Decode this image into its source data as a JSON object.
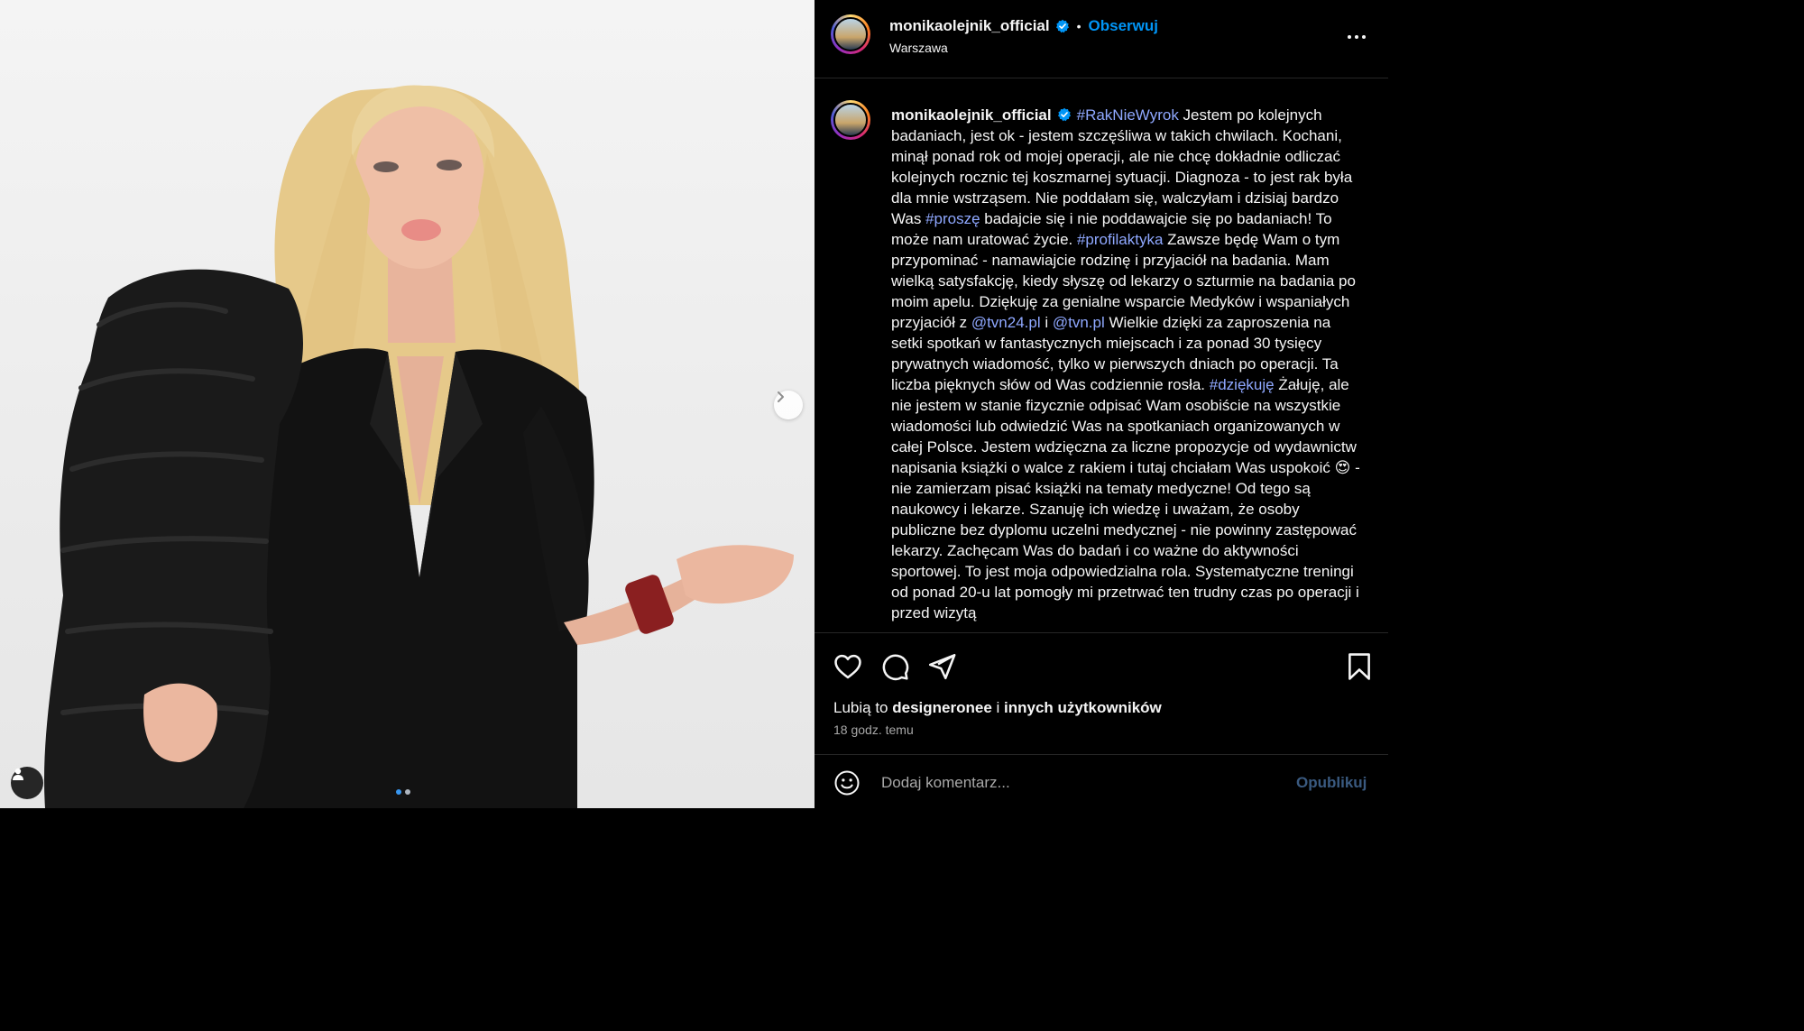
{
  "post": {
    "media": {
      "description_icon": "user-tag-icon",
      "carousel": {
        "count": 2,
        "active": 0
      }
    },
    "header": {
      "username": "monikaolejnik_official",
      "separator": "•",
      "follow_label": "Obserwuj",
      "location": "Warszawa"
    },
    "caption": {
      "username": "monikaolejnik_official",
      "segments": [
        {
          "t": "tag",
          "v": "#RakNieWyrok"
        },
        {
          "t": "text",
          "v": " Jestem po kolejnych badaniach, jest ok - jestem szczęśliwa w takich chwilach. Kochani, minął ponad rok od mojej operacji, ale nie chcę dokładnie odliczać kolejnych rocznic tej koszmarnej sytuacji. Diagnoza - to jest rak była dla mnie wstrząsem. Nie poddałam się, walczyłam i dzisiaj bardzo Was "
        },
        {
          "t": "tag",
          "v": "#proszę"
        },
        {
          "t": "text",
          "v": " badajcie się i nie poddawajcie się po badaniach! To może nam uratować życie. "
        },
        {
          "t": "tag",
          "v": "#profilaktyka"
        },
        {
          "t": "text",
          "v": " Zawsze będę Wam o tym przypominać - namawiajcie rodzinę i przyjaciół na badania. Mam wielką satysfakcję, kiedy słyszę od lekarzy o szturmie na badania po moim apelu. Dziękuję za genialne wsparcie Medyków i wspaniałych przyjaciół z "
        },
        {
          "t": "tag",
          "v": "@tvn24.pl"
        },
        {
          "t": "text",
          "v": " i "
        },
        {
          "t": "tag",
          "v": "@tvn.pl"
        },
        {
          "t": "text",
          "v": " Wielkie dzięki za zaproszenia na setki spotkań w fantastycznych miejscach i za ponad 30 tysięcy prywatnych wiadomość, tylko w pierwszych dniach po operacji. Ta liczba pięknych słów od Was codziennie rosła. "
        },
        {
          "t": "tag",
          "v": "#dziękuję"
        },
        {
          "t": "text",
          "v": " Żałuję, ale nie jestem w stanie fizycznie odpisać Wam osobiście na wszystkie wiadomości lub odwiedzić Was na spotkaniach organizowanych w całej Polsce. Jestem wdzięczna za liczne propozycje od wydawnictw napisania książki o walce z rakiem i tutaj chciałam Was uspokoić 😍 - nie zamierzam pisać książki na tematy medyczne! Od tego są naukowcy i lekarze. Szanuję ich wiedzę i uważam, że osoby publiczne bez dyplomu uczelni medycznej - nie powinny zastępować lekarzy. Zachęcam Was do badań i co ważne do aktywności sportowej. To jest moja odpowiedzialna rola. Systematyczne treningi od ponad 20-u lat pomogły mi przetrwać ten trudny czas po operacji i przed wizytą"
        }
      ]
    },
    "actions": {
      "like_icon": "heart-icon",
      "comment_icon": "comment-icon",
      "share_icon": "paper-plane-icon",
      "save_icon": "bookmark-icon"
    },
    "likes": {
      "prefix": "Lubią to ",
      "user": "designeronee",
      "middle": " i ",
      "others": "innych użytkowników"
    },
    "time": "18 godz. temu",
    "comment": {
      "placeholder": "Dodaj komentarz...",
      "publish_label": "Opublikuj"
    },
    "colors": {
      "accent": "#0095f6",
      "hashtag": "#8fa8ff",
      "publish_disabled": "#3a5a80"
    }
  }
}
